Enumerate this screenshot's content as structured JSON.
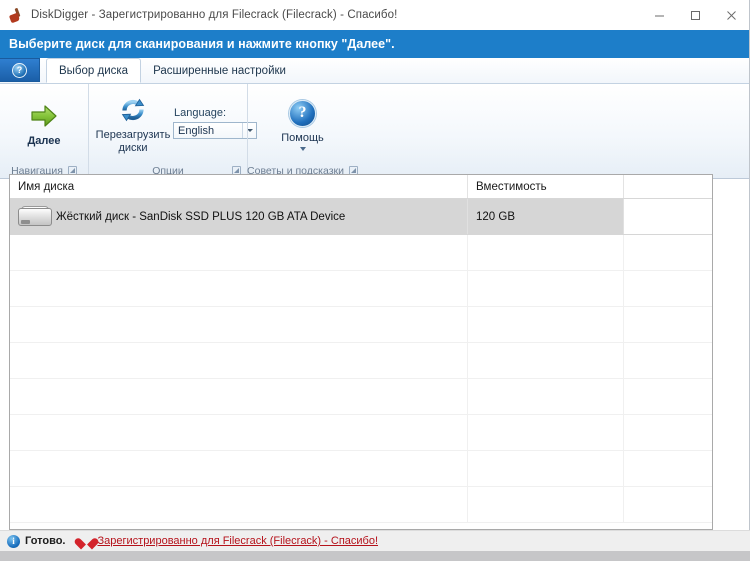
{
  "window": {
    "title": "DiskDigger - Зарегистрированно для Filecrack (Filecrack) - Спасибо!",
    "icon": "shovel-icon",
    "controls": {
      "minimize": "minimize-icon",
      "maximize": "maximize-icon",
      "close": "close-icon"
    }
  },
  "banner": {
    "text": "Выберите диск для сканирования и нажмите кнопку \"Далее\"."
  },
  "tabbar": {
    "quick_access_icon": "help-round-icon",
    "tabs": [
      {
        "label": "Выбор диска",
        "active": true
      },
      {
        "label": "Расширенные настройки",
        "active": false
      }
    ]
  },
  "ribbon": {
    "groups": [
      {
        "label": "Навигация",
        "has_launcher": true,
        "next_button": {
          "label": "Далее",
          "icon": "green-right-arrow-icon"
        }
      },
      {
        "label": "Опции",
        "has_launcher": true,
        "refresh_button": {
          "label": "Перезагрузить диски",
          "icon": "refresh-circular-icon"
        },
        "language": {
          "label": "Language:",
          "value": "English",
          "options": [
            "English"
          ]
        }
      },
      {
        "label": "Советы и подсказки",
        "has_launcher": true,
        "help_button": {
          "label": "Помощь",
          "icon": "blue-question-icon",
          "has_dropdown": true
        }
      }
    ]
  },
  "disk_list": {
    "columns": [
      "Имя диска",
      "Вместимость",
      ""
    ],
    "rows": [
      {
        "icon": "hard-disk-icon",
        "name": "Жёсткий диск - SanDisk SSD PLUS 120 GB ATA Device",
        "capacity": "120 GB",
        "extra": "",
        "selected": true
      },
      {
        "icon": "",
        "name": "",
        "capacity": "",
        "extra": "",
        "selected": false
      },
      {
        "icon": "",
        "name": "",
        "capacity": "",
        "extra": "",
        "selected": false
      },
      {
        "icon": "",
        "name": "",
        "capacity": "",
        "extra": "",
        "selected": false
      },
      {
        "icon": "",
        "name": "",
        "capacity": "",
        "extra": "",
        "selected": false
      },
      {
        "icon": "",
        "name": "",
        "capacity": "",
        "extra": "",
        "selected": false
      },
      {
        "icon": "",
        "name": "",
        "capacity": "",
        "extra": "",
        "selected": false
      },
      {
        "icon": "",
        "name": "",
        "capacity": "",
        "extra": "",
        "selected": false
      },
      {
        "icon": "",
        "name": "",
        "capacity": "",
        "extra": "",
        "selected": false
      }
    ]
  },
  "statusbar": {
    "info_icon": "info-icon",
    "ready_text": "Готово.",
    "heart_icon": "heart-icon",
    "registration_link": "Зарегистрированно для Filecrack (Filecrack) - Спасибо!"
  },
  "colors": {
    "banner_blue": "#1d7ec9",
    "link_red": "#b5121b",
    "selection_gray": "#d6d6d6",
    "arrow_green": "#76b82a"
  }
}
